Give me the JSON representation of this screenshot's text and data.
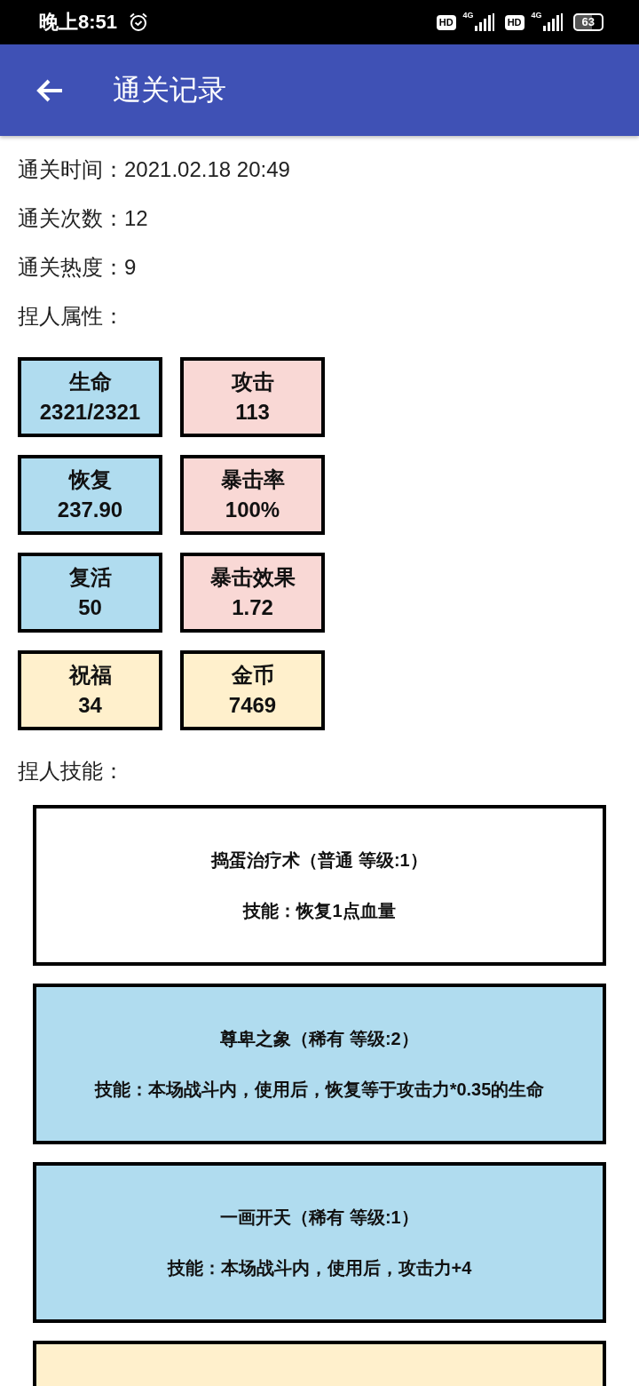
{
  "status_bar": {
    "time": "晚上8:51",
    "sims": [
      {
        "badge": "HD",
        "network": "4G"
      },
      {
        "badge": "HD",
        "network": "4G"
      }
    ],
    "battery": "63"
  },
  "app_bar": {
    "title": "通关记录"
  },
  "info": [
    {
      "label": "通关时间：",
      "value": "2021.02.18 20:49"
    },
    {
      "label": "通关次数：",
      "value": "12"
    },
    {
      "label": "通关热度：",
      "value": "9"
    },
    {
      "label": "捏人属性："
    }
  ],
  "stats": [
    {
      "label": "生命",
      "value": "2321/2321",
      "color": "#b0dcef"
    },
    {
      "label": "攻击",
      "value": "113",
      "color": "#f9d8d5"
    },
    {
      "label": "恢复",
      "value": "237.90",
      "color": "#b0dcef"
    },
    {
      "label": "暴击率",
      "value": "100%",
      "color": "#f9d8d5"
    },
    {
      "label": "复活",
      "value": "50",
      "color": "#b0dcef"
    },
    {
      "label": "暴击效果",
      "value": "1.72",
      "color": "#f9d8d5"
    },
    {
      "label": "祝福",
      "value": "34",
      "color": "#fff0cc"
    },
    {
      "label": "金币",
      "value": "7469",
      "color": "#fff0cc"
    }
  ],
  "skills_heading": "捏人技能：",
  "skills": [
    {
      "title": "捣蛋治疗术（普通 等级:1）",
      "description": "技能：恢复1点血量",
      "color": "#ffffff"
    },
    {
      "title": "尊卑之象（稀有 等级:2）",
      "description": "技能：本场战斗内，使用后，恢复等于攻击力*0.35的生命",
      "color": "#b0dcef"
    },
    {
      "title": "一画开天（稀有 等级:1）",
      "description": "技能：本场战斗内，使用后，攻击力+4",
      "color": "#b0dcef"
    },
    {
      "color": "#fff0cc"
    }
  ]
}
